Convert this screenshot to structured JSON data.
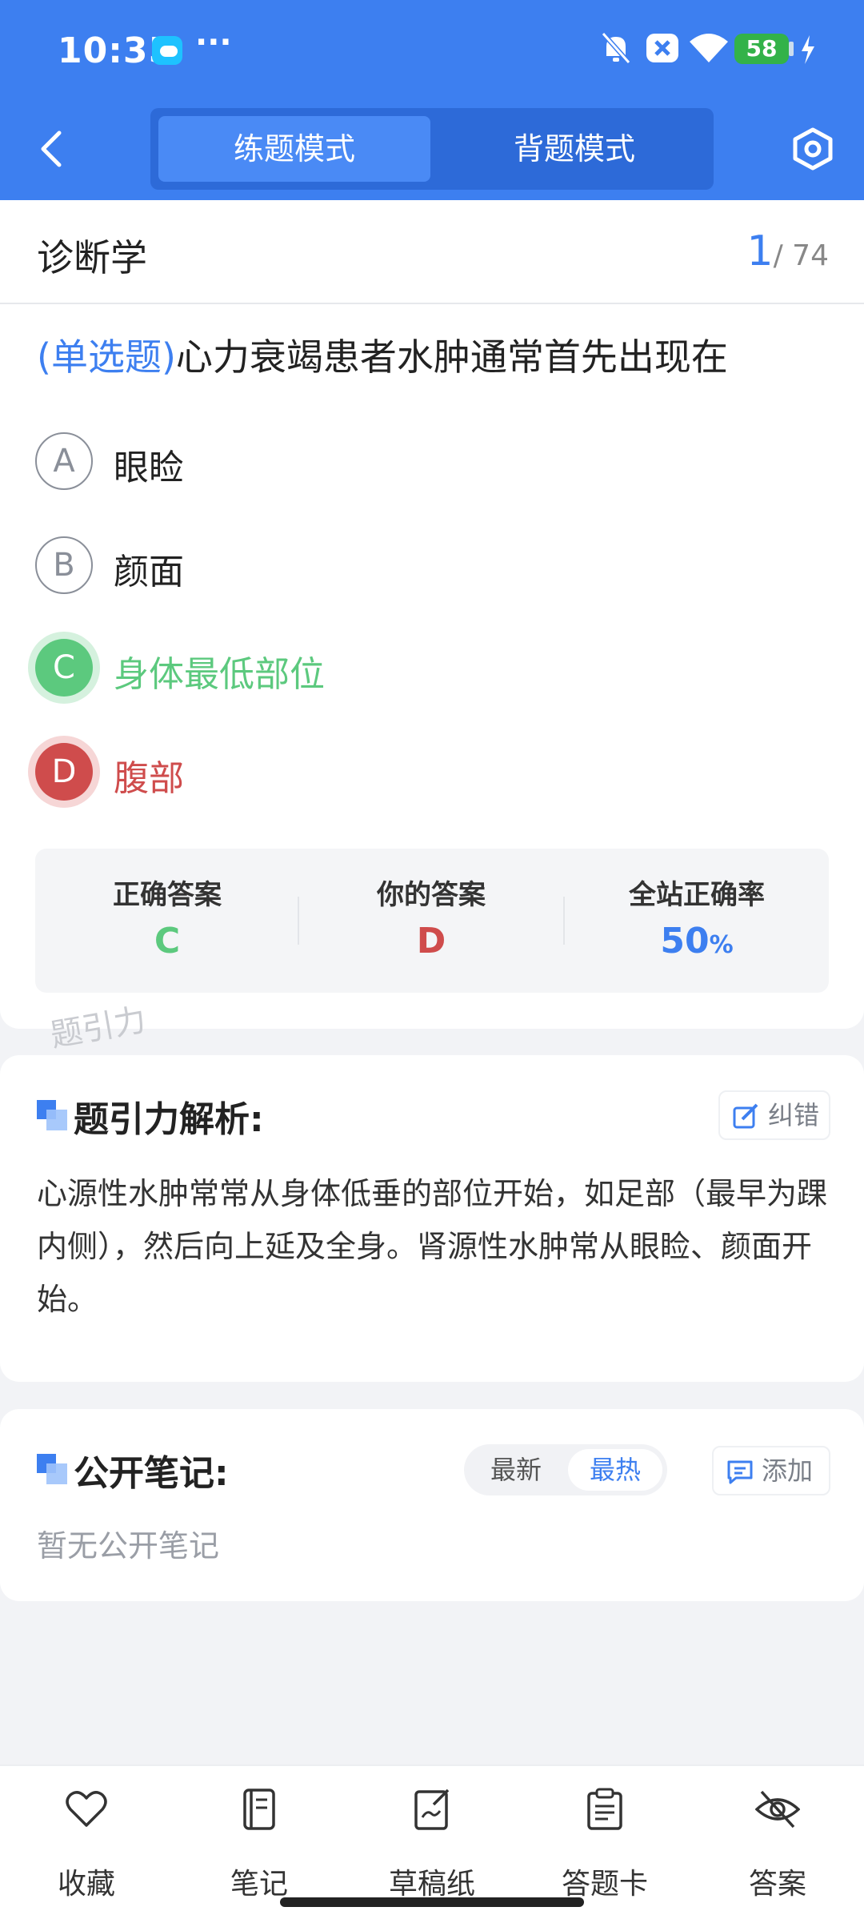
{
  "status_bar": {
    "time": "10:35",
    "dots": "···",
    "battery": "58"
  },
  "header": {
    "tabs": [
      {
        "label": "练题模式",
        "active": true
      },
      {
        "label": "背题模式",
        "active": false
      }
    ]
  },
  "subject": {
    "name": "诊断学",
    "current": "1",
    "total": "/ 74"
  },
  "question": {
    "type": "(单选题)",
    "text": "心力衰竭患者水肿通常首先出现在",
    "options": [
      {
        "letter": "A",
        "text": "眼睑",
        "state": "normal"
      },
      {
        "letter": "B",
        "text": "颜面",
        "state": "normal"
      },
      {
        "letter": "C",
        "text": "身体最低部位",
        "state": "correct"
      },
      {
        "letter": "D",
        "text": "腹部",
        "state": "wrong"
      }
    ]
  },
  "answer_summary": {
    "correct_label": "正确答案",
    "correct_value": "C",
    "yours_label": "你的答案",
    "yours_value": "D",
    "rate_label": "全站正确率",
    "rate_value": "50",
    "rate_unit": "%"
  },
  "watermark": "题引力",
  "analysis": {
    "title": "题引力解析:",
    "report_label": "纠错",
    "text": "心源性水肿常常从身体低垂的部位开始，如足部（最早为踝内侧），然后向上延及全身。肾源性水肿常从眼睑、颜面开始。"
  },
  "notes": {
    "title": "公开笔记:",
    "sort_options": [
      "最新",
      "最热"
    ],
    "active_sort": "最热",
    "add_label": "添加",
    "empty_text": "暂无公开笔记"
  },
  "bottom_tabs": [
    {
      "label": "收藏",
      "icon": "heart-icon"
    },
    {
      "label": "笔记",
      "icon": "notebook-icon"
    },
    {
      "label": "草稿纸",
      "icon": "draft-icon"
    },
    {
      "label": "答题卡",
      "icon": "clipboard-icon"
    },
    {
      "label": "答案",
      "icon": "eye-off-icon"
    }
  ],
  "colors": {
    "primary": "#3d7ff0",
    "correct": "#5cc97e",
    "wrong": "#cf4c4c"
  }
}
